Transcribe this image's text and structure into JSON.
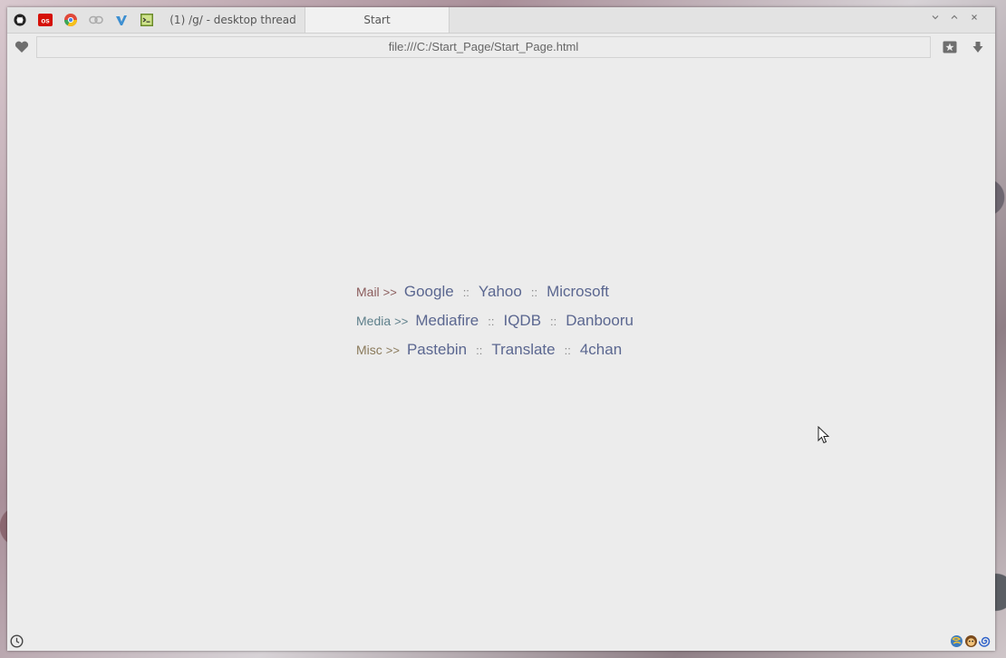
{
  "tabs": {
    "icons": [
      "github-icon",
      "lastfm-icon",
      "chrome-color-icon",
      "link-chain-icon",
      "vimeo-like-icon",
      "terminal-icon"
    ],
    "items": [
      {
        "title": "(1) /g/ - desktop thread"
      },
      {
        "title": "Start"
      }
    ]
  },
  "navbar": {
    "url": "file:///C:/Start_Page/Start_Page.html"
  },
  "links": [
    {
      "category": "Mail",
      "arrow": ">>",
      "color": "#8a5b5b",
      "items": [
        "Google",
        "Yahoo",
        "Microsoft"
      ]
    },
    {
      "category": "Media",
      "arrow": ">>",
      "color": "#5d7f8a",
      "items": [
        "Mediafire",
        "IQDB",
        "Danbooru"
      ]
    },
    {
      "category": "Misc",
      "arrow": ">>",
      "color": "#8a7a5b",
      "items": [
        "Pastebin",
        "Translate",
        "4chan"
      ]
    }
  ],
  "separator": "::",
  "colors": {
    "link": "#5b6790",
    "window_bg": "#ececec"
  }
}
